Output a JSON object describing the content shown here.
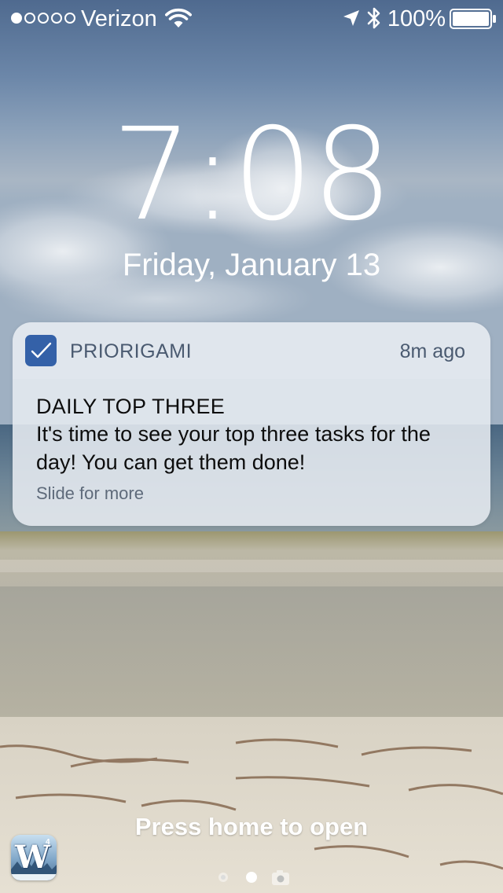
{
  "status_bar": {
    "carrier": "Verizon",
    "signal_bars_filled": 1,
    "signal_bars_total": 5,
    "battery_percent": "100%",
    "battery_level": 1.0,
    "icons": [
      "wifi-icon",
      "location-arrow-icon",
      "bluetooth-icon",
      "battery-icon"
    ]
  },
  "lock_screen": {
    "time": "7:08",
    "date": "Friday, January 13",
    "press_home_label": "Press home to open"
  },
  "notification": {
    "app_name": "PRIORIGAMI",
    "time_ago": "8m ago",
    "title": "DAILY TOP THREE",
    "message": "It's time to see your top three tasks for the day! You can get them done!",
    "hint": "Slide for more",
    "app_icon": "checkmark-icon",
    "app_icon_color": "#3461a8"
  },
  "suggested_app": {
    "letter": "W",
    "superscript": "4",
    "icon": "words-game-app-icon"
  },
  "page_indicator": {
    "pages": [
      "widgets",
      "lock",
      "camera"
    ],
    "active_index": 1
  },
  "colors": {
    "notification_bg": "#e6eaf0",
    "notification_secondary_text": "#4a5a70",
    "notification_text": "#0d0d0d"
  }
}
